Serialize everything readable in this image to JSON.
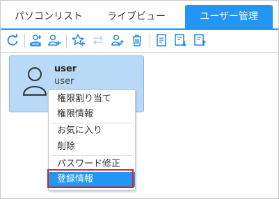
{
  "tabs": [
    {
      "label": "パソコンリスト",
      "active": false
    },
    {
      "label": "ライブビュー",
      "active": false
    },
    {
      "label": "ユーザー管理",
      "active": true
    }
  ],
  "toolbar": {
    "icons": [
      "refresh-icon",
      "add-user-group-icon",
      "add-user-icon",
      "favorite-add-icon",
      "transfer-icon",
      "user-edit-icon",
      "delete-icon",
      "document-icon",
      "export-icon",
      "import-icon"
    ]
  },
  "user_card": {
    "name": "user",
    "id": "user"
  },
  "context_menu": {
    "items": [
      {
        "label": "権限割り当て"
      },
      {
        "label": "権限情報"
      },
      {
        "label": "お気に入り"
      },
      {
        "label": "削除"
      },
      {
        "label": "パスワード修正"
      },
      {
        "label": "登録情報",
        "selected": true
      }
    ]
  },
  "colors": {
    "accent": "#2196f3",
    "card_bg": "#b9daf6",
    "highlight_border": "#e02020"
  }
}
